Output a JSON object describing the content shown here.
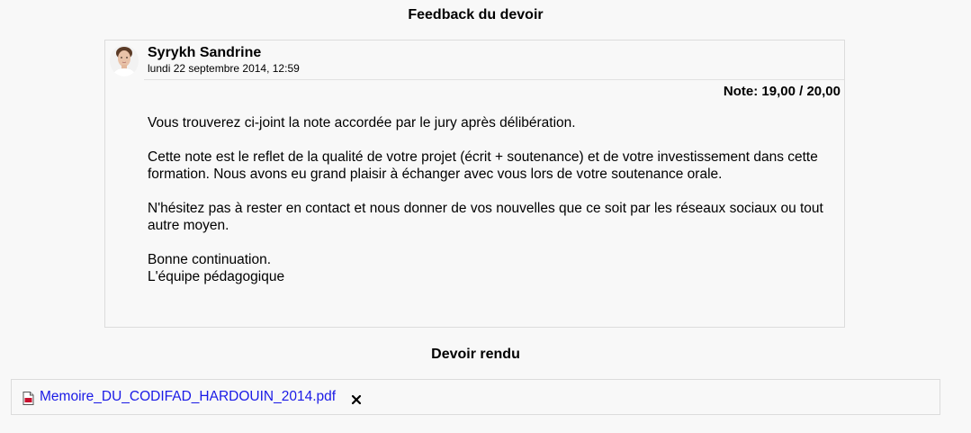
{
  "feedback": {
    "heading": "Feedback du devoir",
    "grader_name": "Syrykh Sandrine",
    "date": "lundi 22 septembre 2014, 12:59",
    "grade": "Note: 19,00 / 20,00",
    "comments": [
      "Vous trouverez ci-joint la note accordée par le jury après délibération.",
      "Cette note est le reflet de la qualité de votre projet (écrit + soutenance) et de votre investissement dans cette formation. Nous avons eu grand plaisir à échanger avec vous lors de votre soutenance orale.",
      "N'hésitez pas à rester en contact et nous donner de vos nouvelles que ce soit par les réseaux sociaux ou tout autre moyen.",
      "Bonne continuation.",
      "L'équipe pédagogique"
    ]
  },
  "submission": {
    "heading": "Devoir rendu",
    "file_name": "Memoire_DU_CODIFAD_HARDOUIN_2014.pdf",
    "file_icon": "pdf-icon",
    "remove_icon": "close-icon"
  },
  "colors": {
    "background": "#f8f8f8",
    "border": "#dcdcdc",
    "link": "#1a1ae6",
    "pdf_red": "#c8102e"
  }
}
